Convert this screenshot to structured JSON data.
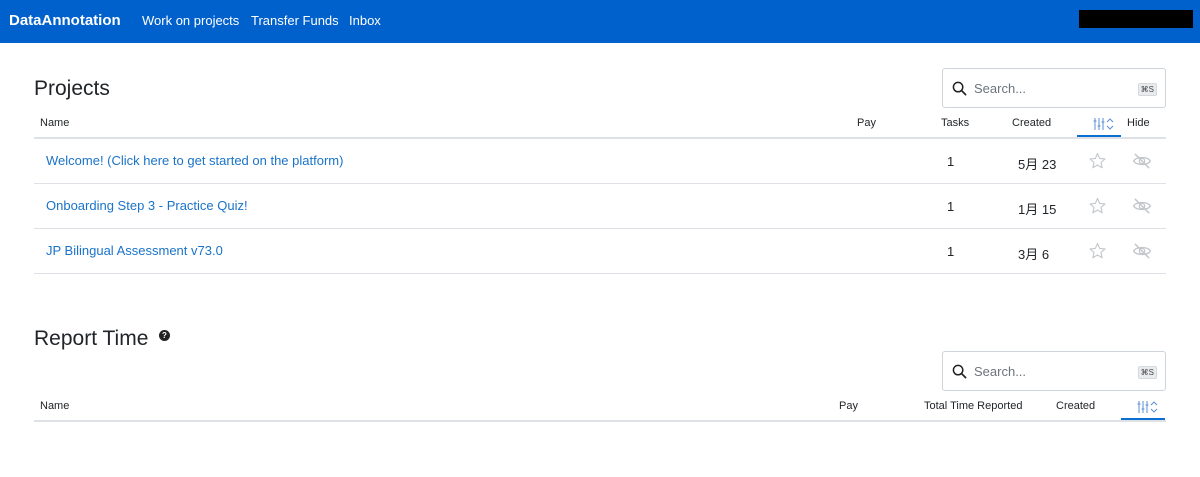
{
  "navbar": {
    "brand": "DataAnnotation",
    "links": [
      "Work on projects",
      "Transfer Funds",
      "Inbox"
    ]
  },
  "projects": {
    "title": "Projects",
    "search": {
      "placeholder": "Search...",
      "shortcut": "⌘S"
    },
    "columns": {
      "name": "Name",
      "pay": "Pay",
      "tasks": "Tasks",
      "created": "Created",
      "hide": "Hide"
    },
    "rows": [
      {
        "name": "Welcome! (Click here to get started on the platform)",
        "pay": "",
        "tasks": "1",
        "created": "5月 23"
      },
      {
        "name": "Onboarding Step 3 - Practice Quiz!",
        "pay": "",
        "tasks": "1",
        "created": "1月 15"
      },
      {
        "name": "JP Bilingual Assessment v73.0",
        "pay": "",
        "tasks": "1",
        "created": "3月 6"
      }
    ]
  },
  "report_time": {
    "title": "Report Time",
    "help_symbol": "?",
    "search": {
      "placeholder": "Search...",
      "shortcut": "⌘S"
    },
    "columns": {
      "name": "Name",
      "pay": "Pay",
      "total_time": "Total Time Reported",
      "created": "Created"
    }
  },
  "icons": {
    "search": "search-icon",
    "star": "star-icon",
    "hide": "eye-slash-icon",
    "sort": "sliders-sort-icon",
    "help": "question-circle-icon"
  },
  "colors": {
    "navbar": "#0060cc",
    "link": "#1a73c9",
    "accent": "#0a6fd1"
  }
}
